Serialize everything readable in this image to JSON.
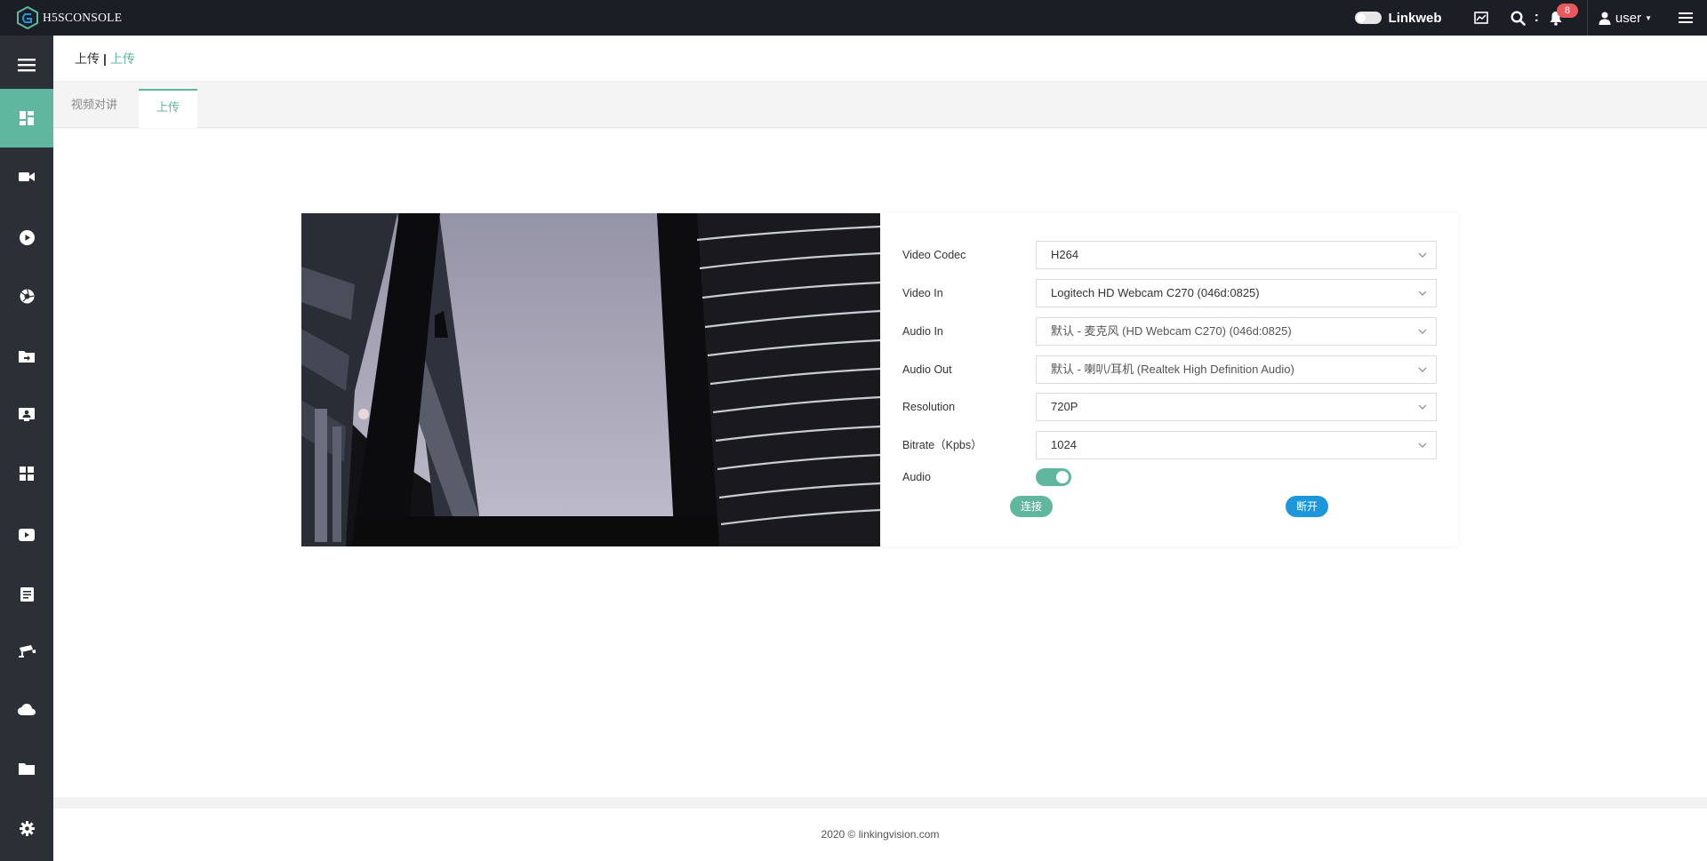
{
  "app": {
    "logo_text": "H5SCONSOLE"
  },
  "topbar": {
    "linkweb_label": "Linkweb",
    "notification_count": "8",
    "user_label": "user"
  },
  "sidebar": {
    "items": [
      {
        "icon": "menu-icon",
        "active": false
      },
      {
        "icon": "dashboard-icon",
        "active": true
      },
      {
        "icon": "video-camera-icon",
        "active": false
      },
      {
        "icon": "play-circle-icon",
        "active": false
      },
      {
        "icon": "aperture-icon",
        "active": false
      },
      {
        "icon": "folder-upload-icon",
        "active": false
      },
      {
        "icon": "contact-card-icon",
        "active": false
      },
      {
        "icon": "grid-icon",
        "active": false
      },
      {
        "icon": "play-box-icon",
        "active": false
      },
      {
        "icon": "document-icon",
        "active": false
      },
      {
        "icon": "cctv-camera-icon",
        "active": false
      },
      {
        "icon": "cloud-icon",
        "active": false
      },
      {
        "icon": "folder-icon",
        "active": false
      },
      {
        "icon": "gear-icon",
        "active": false
      }
    ]
  },
  "breadcrumb": {
    "home": "上传",
    "separator": "|",
    "current": "上传"
  },
  "tabs": [
    {
      "label": "视频对讲",
      "active": false
    },
    {
      "label": "上传",
      "active": true
    }
  ],
  "form": {
    "video_codec": {
      "label": "Video Codec",
      "value": "H264"
    },
    "video_in": {
      "label": "Video In",
      "value": "Logitech HD Webcam C270 (046d:0825)"
    },
    "audio_in": {
      "label": "Audio In",
      "value": "默认 - 麦克风 (HD Webcam C270) (046d:0825)"
    },
    "audio_out": {
      "label": "Audio Out",
      "value": "默认 - 喇叭/耳机 (Realtek High Definition Audio)"
    },
    "resolution": {
      "label": "Resolution",
      "value": "720P"
    },
    "bitrate": {
      "label": "Bitrate（Kpbs）",
      "value": "1024"
    },
    "audio": {
      "label": "Audio",
      "enabled": true
    },
    "connect_label": "连接",
    "disconnect_label": "断开"
  },
  "footer": {
    "text": "2020 © linkingvision.com"
  },
  "colors": {
    "accent": "#5fb7a0",
    "blue": "#1e96dc",
    "topbar": "#1b1e24",
    "sidebar": "#2b2f36",
    "badge": "#e8585c"
  }
}
